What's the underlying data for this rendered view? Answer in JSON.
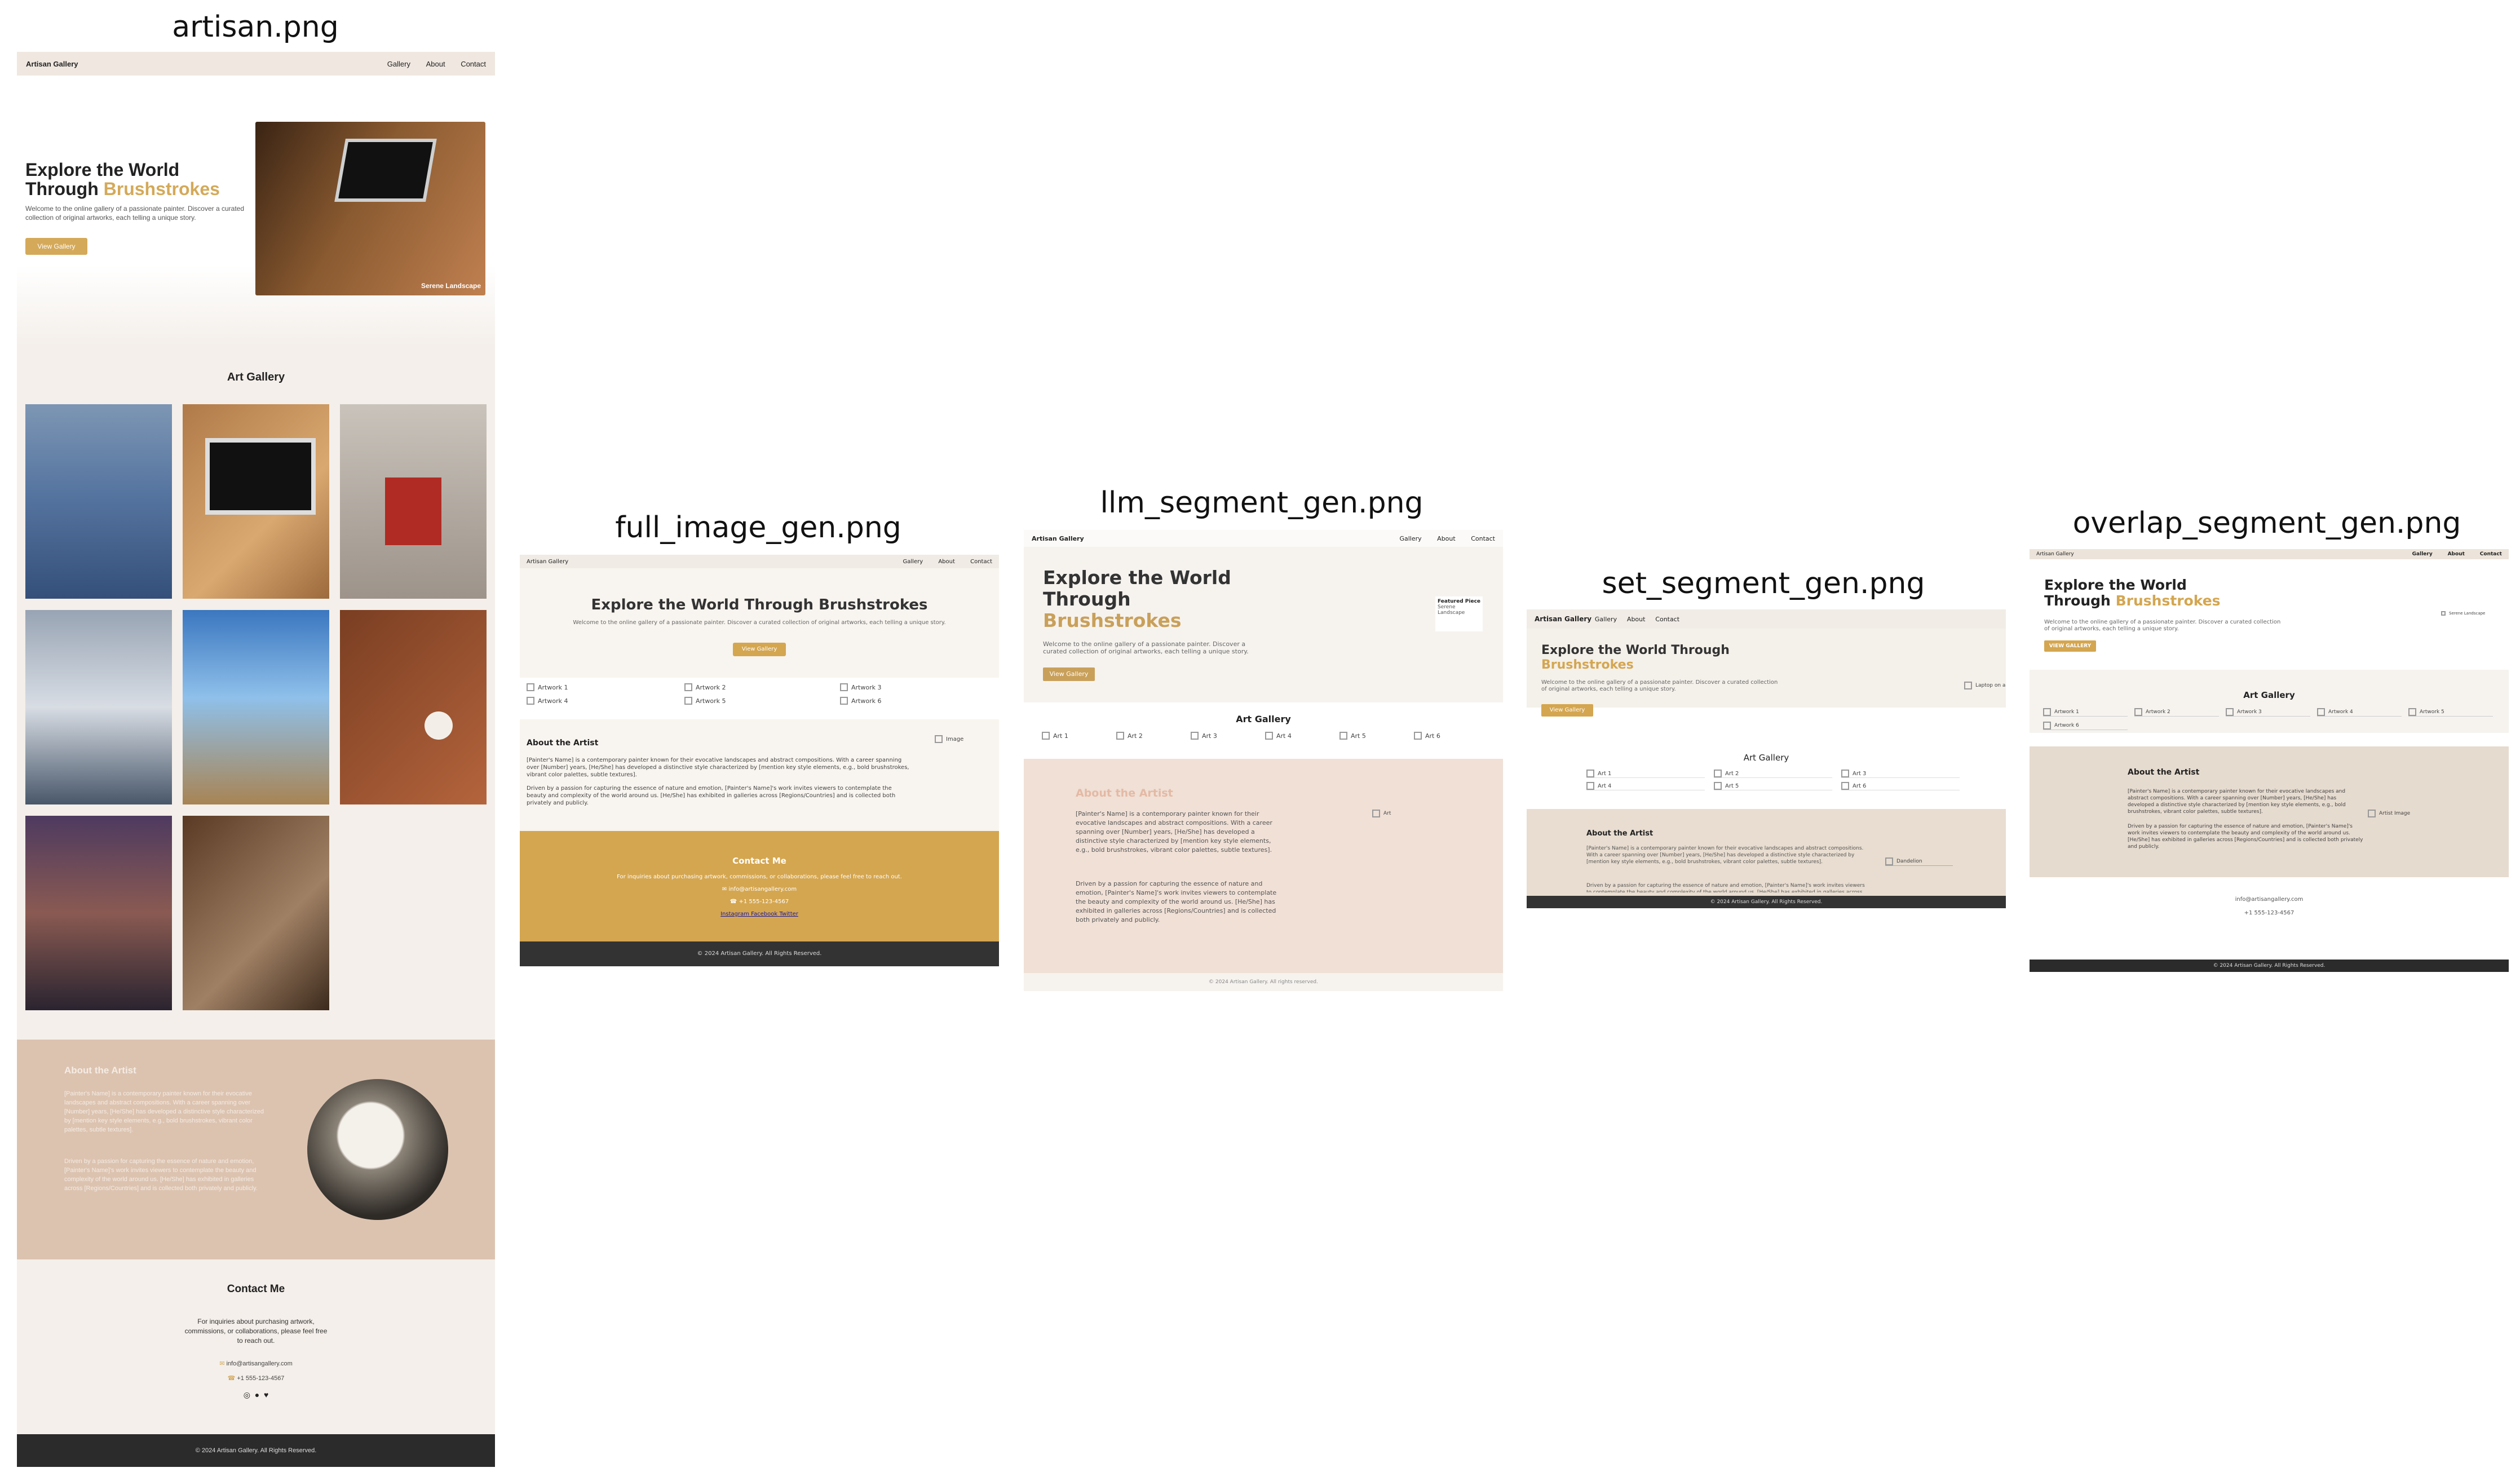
{
  "captions": {
    "p1": "artisan.png",
    "p2": "full_image_gen.png",
    "p3": "llm_segment_gen.png",
    "p4": "set_segment_gen.png",
    "p5": "overlap_segment_gen.png"
  },
  "artisan": {
    "brand": "Artisan Gallery",
    "nav": [
      "Gallery",
      "About",
      "Contact"
    ],
    "hero_title_1": "Explore the World",
    "hero_title_2": "Through",
    "hero_title_accent": "Brushstrokes",
    "hero_text": "Welcome to the online gallery of a passionate painter. Discover a curated collection of original artworks, each telling a unique story.",
    "hero_button": "View Gallery",
    "hero_image_caption": "Serene Landscape",
    "gallery_title": "Art Gallery",
    "about_title": "About the Artist",
    "about_p1": "[Painter's Name] is a contemporary painter known for their evocative landscapes and abstract compositions. With a career spanning over [Number] years, [He/She] has developed a distinctive style characterized by [mention key style elements, e.g., bold brushstrokes, vibrant color palettes, subtle textures].",
    "about_p2": "Driven by a passion for capturing the essence of nature and emotion, [Painter's Name]'s work invites viewers to contemplate the beauty and complexity of the world around us. [He/She] has exhibited in galleries across [Regions/Countries] and is collected both privately and publicly.",
    "contact_title": "Contact Me",
    "contact_text": "For inquiries about purchasing artwork, commissions, or collaborations, please feel free to reach out.",
    "email": "info@artisangallery.com",
    "phone": "+1 555-123-4567",
    "footer": "© 2024 Artisan Gallery. All Rights Reserved."
  },
  "full_gen": {
    "brand": "Artisan Gallery",
    "nav": [
      "Gallery",
      "About",
      "Contact"
    ],
    "hero_title": "Explore the World Through Brushstrokes",
    "hero_text": "Welcome to the online gallery of a passionate painter. Discover a curated collection of original artworks, each telling a unique story.",
    "hero_button": "View Gallery",
    "artworks": [
      "Artwork 1",
      "Artwork 2",
      "Artwork 3",
      "Artwork 4",
      "Artwork 5",
      "Artwork 6"
    ],
    "about_title": "About the Artist",
    "about_image_alt": "Image",
    "about_p1": "[Painter's Name] is a contemporary painter known for their evocative landscapes and abstract compositions. With a career spanning over [Number] years, [He/She] has developed a distinctive style characterized by [mention key style elements, e.g., bold brushstrokes, vibrant color palettes, subtle textures].",
    "about_p2": "Driven by a passion for capturing the essence of nature and emotion, [Painter's Name]'s work invites viewers to contemplate the beauty and complexity of the world around us. [He/She] has exhibited in galleries across [Regions/Countries] and is collected both privately and publicly.",
    "contact_title": "Contact Me",
    "contact_text": "For inquiries about purchasing artwork, commissions, or collaborations, please feel free to reach out.",
    "email": "info@artisangallery.com",
    "phone": "+1 555-123-4567",
    "social": [
      "Instagram",
      "Facebook",
      "Twitter"
    ],
    "footer": "© 2024 Artisan Gallery. All Rights Reserved."
  },
  "llm_gen": {
    "brand": "Artisan Gallery",
    "nav": [
      "Gallery",
      "About",
      "Contact"
    ],
    "hero_title_1": "Explore the World",
    "hero_title_2": "Through",
    "hero_title_accent": "Brushstrokes",
    "hero_text": "Welcome to the online gallery of a passionate painter. Discover a curated collection of original artworks, each telling a unique story.",
    "hero_button": "View Gallery",
    "featured_alt": "Featured Piece",
    "featured_caption": "Serene Landscape",
    "gallery_title": "Art Gallery",
    "arts": [
      "Art 1",
      "Art 2",
      "Art 3",
      "Art 4",
      "Art 5",
      "Art 6"
    ],
    "about_title": "About the Artist",
    "about_p1": "[Painter's Name] is a contemporary painter known for their evocative landscapes and abstract compositions. With a career spanning over [Number] years, [He/She] has developed a distinctive style characterized by [mention key style elements, e.g., bold brushstrokes, vibrant color palettes, subtle textures].",
    "about_p2": "Driven by a passion for capturing the essence of nature and emotion, [Painter's Name]'s work invites viewers to contemplate the beauty and complexity of the world around us. [He/She] has exhibited in galleries across [Regions/Countries] and is collected both privately and publicly.",
    "about_image_alt": "Art",
    "footer": "© 2024 Artisan Gallery. All rights reserved."
  },
  "set_gen": {
    "brand": "Artisan Gallery",
    "nav": [
      "Gallery",
      "About",
      "Contact"
    ],
    "hero_title": "Explore the World Through",
    "hero_title_accent": "Brushstrokes",
    "hero_text": "Welcome to the online gallery of a passionate painter. Discover a curated collection of original artworks, each telling a unique story.",
    "hero_button": "View Gallery",
    "hero_image_alt": "Laptop on a",
    "gallery_title": "Art Gallery",
    "arts": [
      "Art 1",
      "Art 2",
      "Art 3",
      "Art 4",
      "Art 5",
      "Art 6"
    ],
    "about_title": "About the Artist",
    "about_p1": "[Painter's Name] is a contemporary painter known for their evocative landscapes and abstract compositions. With a career spanning over [Number] years, [He/She] has developed a distinctive style characterized by [mention key style elements, e.g., bold brushstrokes, vibrant color palettes, subtle textures].",
    "about_p2": "Driven by a passion for capturing the essence of nature and emotion, [Painter's Name]'s work invites viewers to contemplate the beauty and complexity of the world around us. [He/She] has exhibited in galleries across [Regions/Countries] and is collected both privately and publicly.",
    "about_image_alt": "Dandelion",
    "footer": "© 2024 Artisan Gallery. All Rights Reserved."
  },
  "overlap_gen": {
    "brand": "Artisan Gallery",
    "nav": [
      "Gallery",
      "About",
      "Contact"
    ],
    "hero_title_1": "Explore the World",
    "hero_title_2": "Through",
    "hero_title_accent": "Brushstrokes",
    "hero_text": "Welcome to the online gallery of a passionate painter. Discover a curated collection of original artworks, each telling a unique story.",
    "hero_button": "VIEW GALLERY",
    "hero_image_alt": "Serene Landscape",
    "gallery_title": "Art Gallery",
    "artworks": [
      "Artwork 1",
      "Artwork 2",
      "Artwork 3",
      "Artwork 4",
      "Artwork 5",
      "Artwork 6"
    ],
    "about_title": "About the Artist",
    "about_p1": "[Painter's Name] is a contemporary painter known for their evocative landscapes and abstract compositions. With a career spanning over [Number] years, [He/She] has developed a distinctive style characterized by [mention key style elements, e.g., bold brushstrokes, vibrant color palettes, subtle textures].",
    "about_p2": "Driven by a passion for capturing the essence of nature and emotion, [Painter's Name]'s work invites viewers to contemplate the beauty and complexity of the world around us. [He/She] has exhibited in galleries across [Regions/Countries] and is collected both privately and publicly.",
    "about_image_alt": "Artist Image",
    "email": "info@artisangallery.com",
    "phone": "+1 555-123-4567",
    "footer": "© 2024 Artisan Gallery. All Rights Reserved."
  },
  "colors": {
    "accent": "#d4a959",
    "gold": "#d4a650",
    "cream": "#f4efe9",
    "about_bg": "#dcc3b0",
    "footer_dark": "#2b2b2b"
  }
}
